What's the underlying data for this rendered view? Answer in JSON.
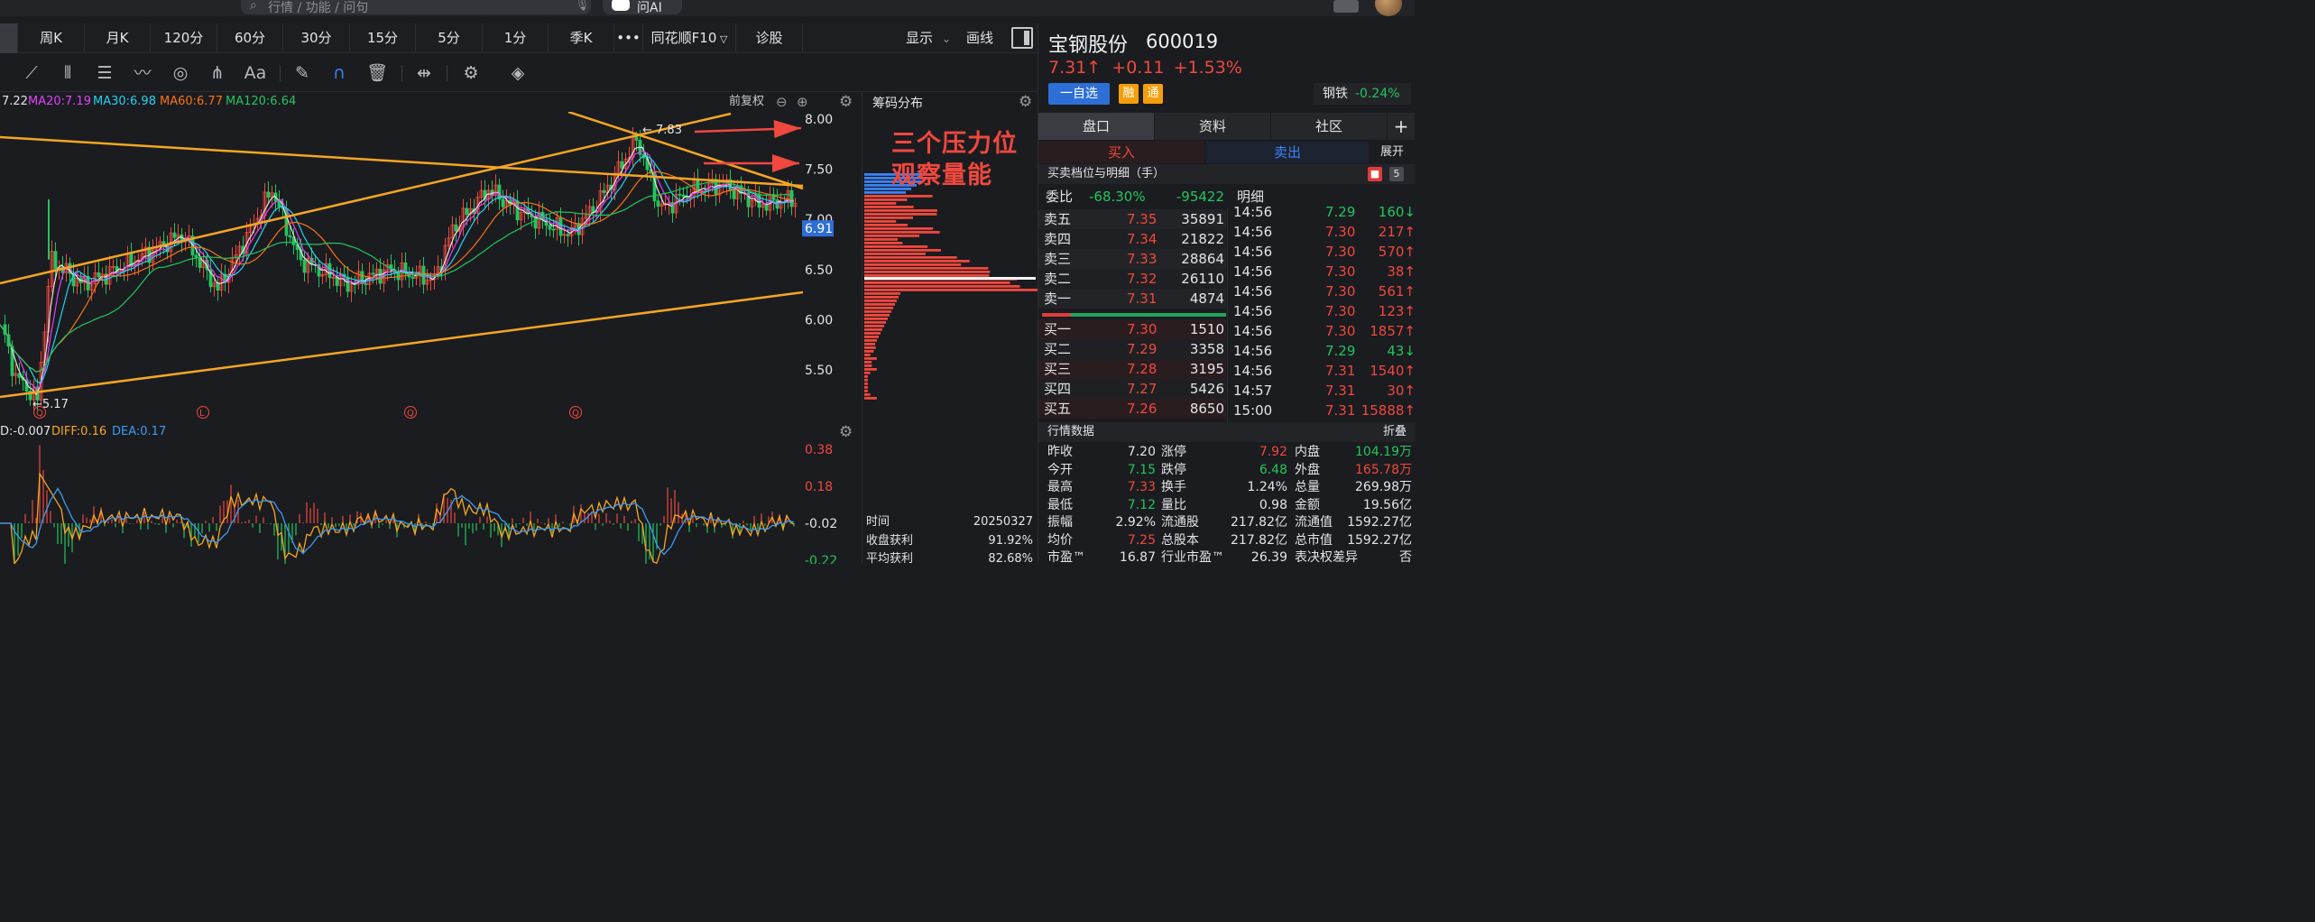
{
  "search": {
    "placeholder": "行情 / 功能 / 问句",
    "ask_ai": "问AI"
  },
  "periods": [
    "周K",
    "月K",
    "120分",
    "60分",
    "30分",
    "15分",
    "5分",
    "1分",
    "季K",
    "•••",
    "同花顺F10",
    "诊股"
  ],
  "display_label": "显示",
  "draw_label": "画线",
  "ma_legend": {
    "ma10": "7.22",
    "ma20": "MA20:7.19",
    "ma30": "MA30:6.98",
    "ma60": "MA60:6.77",
    "ma120": "MA120:6.64",
    "fuquan": "前复权"
  },
  "price_axis": [
    "8.00",
    "7.50",
    "7.00",
    "6.50",
    "6.00",
    "5.50"
  ],
  "current_price_tag": "6.91",
  "high_label": "← 7.83",
  "low_label": "←5.17",
  "event_markers": [
    "Q",
    "L",
    "Q",
    "Q"
  ],
  "macd": {
    "dif": "D:-0.007",
    "diff": "DIFF:0.16",
    "dea": "DEA:0.17",
    "axis": [
      "0.38",
      "0.18",
      "-0.02",
      "-0.22"
    ]
  },
  "chip": {
    "title": "筹码分布",
    "annotation_line1": "三个压力位",
    "annotation_line2": "观察量能",
    "stats": [
      {
        "k": "时间",
        "v": "20250327"
      },
      {
        "k": "收盘获利",
        "v": "91.92%"
      },
      {
        "k": "平均获利",
        "v": "82.68%"
      }
    ]
  },
  "stock": {
    "name": "宝钢股份",
    "code": "600019",
    "price": "7.31↑",
    "change": "+0.11",
    "pct": "+1.53%",
    "add_watch": "一自选",
    "badge1": "融",
    "badge2": "通",
    "industry": "钢铁",
    "industry_pct": "-0.24%"
  },
  "rtabs": [
    "盘口",
    "资料",
    "社区",
    "+"
  ],
  "bstabs": {
    "buy": "买入",
    "sell": "卖出",
    "expand": "展开"
  },
  "orderbook": {
    "title": "买卖档位与明细（手）",
    "level_count": "5",
    "weibi_label": "委比",
    "weibi_pct": "-68.30%",
    "weibi_val": "-95422",
    "mingxi": "明细",
    "asks": [
      {
        "n": "卖五",
        "p": "7.35",
        "q": "35891"
      },
      {
        "n": "卖四",
        "p": "7.34",
        "q": "21822"
      },
      {
        "n": "卖三",
        "p": "7.33",
        "q": "28864"
      },
      {
        "n": "卖二",
        "p": "7.32",
        "q": "26110"
      },
      {
        "n": "卖一",
        "p": "7.31",
        "q": "4874"
      }
    ],
    "bids": [
      {
        "n": "买一",
        "p": "7.30",
        "q": "1510"
      },
      {
        "n": "买二",
        "p": "7.29",
        "q": "3358"
      },
      {
        "n": "买三",
        "p": "7.28",
        "q": "3195"
      },
      {
        "n": "买四",
        "p": "7.27",
        "q": "5426"
      },
      {
        "n": "买五",
        "p": "7.26",
        "q": "8650"
      }
    ]
  },
  "ticks": [
    {
      "t": "14:56",
      "p": "7.29",
      "v": "160↓",
      "c": "g"
    },
    {
      "t": "14:56",
      "p": "7.30",
      "v": "217↑",
      "c": "r"
    },
    {
      "t": "14:56",
      "p": "7.30",
      "v": "570↑",
      "c": "r"
    },
    {
      "t": "14:56",
      "p": "7.30",
      "v": "38↑",
      "c": "r"
    },
    {
      "t": "14:56",
      "p": "7.30",
      "v": "561↑",
      "c": "r"
    },
    {
      "t": "14:56",
      "p": "7.30",
      "v": "123↑",
      "c": "r"
    },
    {
      "t": "14:56",
      "p": "7.30",
      "v": "1857↑",
      "c": "r"
    },
    {
      "t": "14:56",
      "p": "7.29",
      "v": "43↓",
      "c": "g"
    },
    {
      "t": "14:56",
      "p": "7.31",
      "v": "1540↑",
      "c": "r"
    },
    {
      "t": "14:57",
      "p": "7.31",
      "v": "30↑",
      "c": "r"
    },
    {
      "t": "15:00",
      "p": "7.31",
      "v": "15888↑",
      "c": "r"
    }
  ],
  "quote": {
    "title": "行情数据",
    "fold": "折叠",
    "rows": [
      [
        {
          "k": "昨收",
          "v": "7.20",
          "c": "w"
        },
        {
          "k": "涨停",
          "v": "7.92",
          "c": "r"
        },
        {
          "k": "内盘",
          "v": "104.19万",
          "c": "g"
        }
      ],
      [
        {
          "k": "今开",
          "v": "7.15",
          "c": "g"
        },
        {
          "k": "跌停",
          "v": "6.48",
          "c": "g"
        },
        {
          "k": "外盘",
          "v": "165.78万",
          "c": "r"
        }
      ],
      [
        {
          "k": "最高",
          "v": "7.33",
          "c": "r"
        },
        {
          "k": "换手",
          "v": "1.24%",
          "c": "w"
        },
        {
          "k": "总量",
          "v": "269.98万",
          "c": "w"
        }
      ],
      [
        {
          "k": "最低",
          "v": "7.12",
          "c": "g"
        },
        {
          "k": "量比",
          "v": "0.98",
          "c": "w"
        },
        {
          "k": "金额",
          "v": "19.56亿",
          "c": "w"
        }
      ],
      [
        {
          "k": "振幅",
          "v": "2.92%",
          "c": "w"
        },
        {
          "k": "流通股",
          "v": "217.82亿",
          "c": "w"
        },
        {
          "k": "流通值",
          "v": "1592.27亿",
          "c": "w"
        }
      ],
      [
        {
          "k": "均价",
          "v": "7.25",
          "c": "r"
        },
        {
          "k": "总股本",
          "v": "217.82亿",
          "c": "w"
        },
        {
          "k": "总市值",
          "v": "1592.27亿",
          "c": "w"
        }
      ],
      [
        {
          "k": "市盈™",
          "v": "16.87",
          "c": "w"
        },
        {
          "k": "行业市盈™",
          "v": "26.39",
          "c": "w"
        },
        {
          "k": "表决权差异",
          "v": "否",
          "c": "w"
        }
      ]
    ]
  },
  "colors": {
    "up": "#f0483e",
    "down": "#22c55e",
    "trend": "#f5a623",
    "accent": "#2d6fd6",
    "ma20": "#e040fb",
    "ma30": "#22d3ee",
    "ma60": "#f97316",
    "ma120": "#22c55e"
  }
}
